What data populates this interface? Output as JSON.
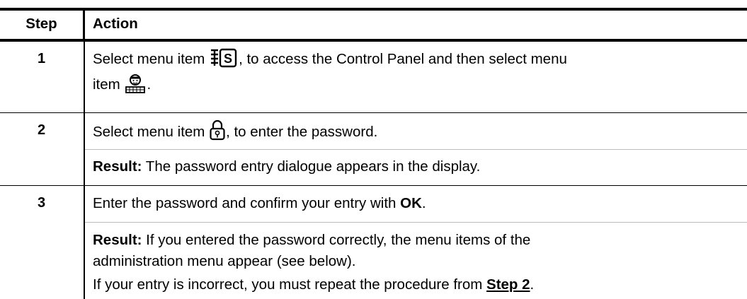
{
  "header": {
    "step": "Step",
    "action": "Action"
  },
  "rows": [
    {
      "step": "1",
      "line1_a": "Select menu item ",
      "line1_b": ", to access the Control Panel and then select menu",
      "line2_a": "item ",
      "line2_b": "."
    },
    {
      "step": "2",
      "text_a": "Select menu item ",
      "text_b": ", to enter the password.",
      "result_label": "Result:",
      "result_text": " The password entry dialogue appears in the display."
    },
    {
      "step": "3",
      "text_a": "Enter the password and confirm your entry with ",
      "text_ok": "OK",
      "text_b": ".",
      "result_label": "Result:",
      "result_line1": " If you entered the password correctly, the menu items of the",
      "result_line2": "administration menu appear (see below).",
      "note_a": "If your entry is incorrect, you must repeat the procedure from ",
      "note_link": "Step 2",
      "note_b": "."
    }
  ],
  "icons": {
    "control_panel": "settings-list-icon",
    "admin": "user-keyboard-icon",
    "password": "padlock-icon"
  }
}
